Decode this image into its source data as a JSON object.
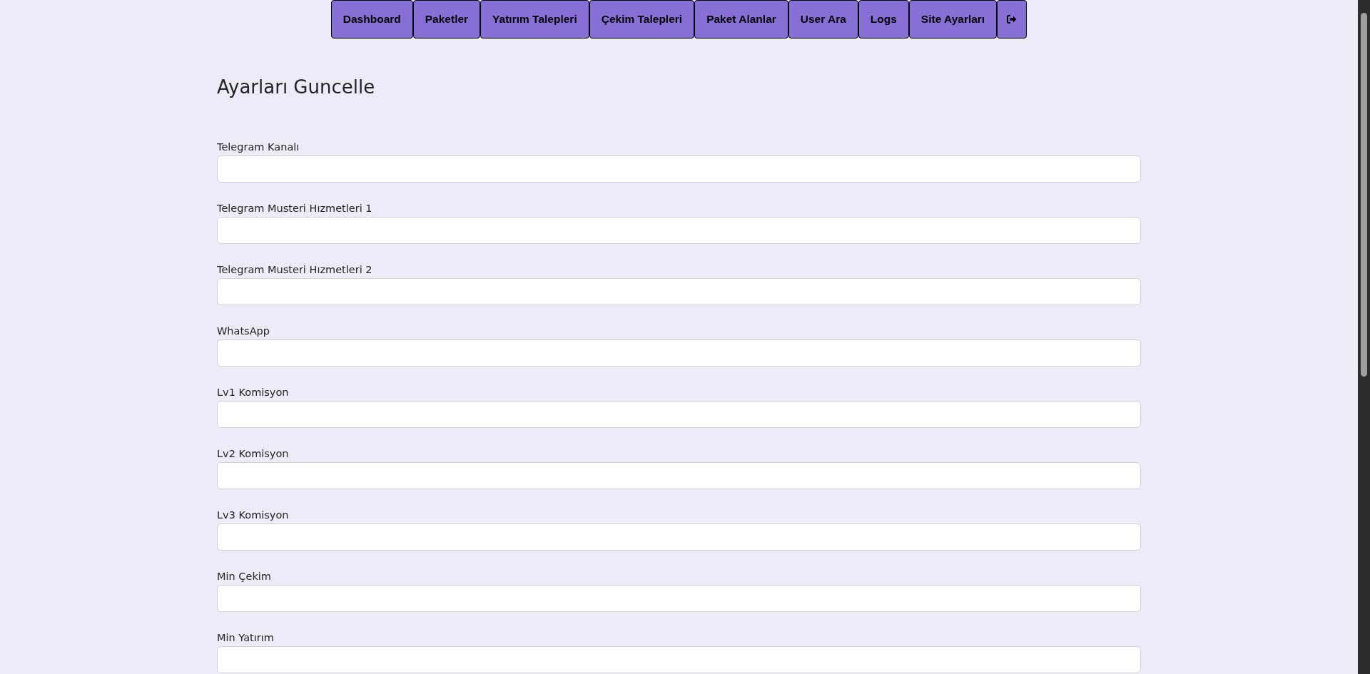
{
  "nav": [
    {
      "label": "Dashboard",
      "kind": "text"
    },
    {
      "label": "Paketler",
      "kind": "text"
    },
    {
      "label": "Yatırım Talepleri",
      "kind": "text"
    },
    {
      "label": "Çekim Talepleri",
      "kind": "text"
    },
    {
      "label": "Paket Alanlar",
      "kind": "text"
    },
    {
      "label": "User Ara",
      "kind": "text"
    },
    {
      "label": "Logs",
      "kind": "text"
    },
    {
      "label": "Site Ayarları",
      "kind": "text"
    },
    {
      "kind": "logout"
    }
  ],
  "title": "Ayarları Guncelle",
  "fields": [
    {
      "label": "Telegram Kanalı"
    },
    {
      "label": "Telegram Musteri Hızmetleri 1"
    },
    {
      "label": "Telegram Musteri Hızmetleri 2"
    },
    {
      "label": "WhatsApp"
    },
    {
      "label": "Lv1 Komisyon"
    },
    {
      "label": "Lv2 Komisyon"
    },
    {
      "label": "Lv3 Komisyon"
    },
    {
      "label": "Min Çekim"
    },
    {
      "label": "Min Yatırım"
    }
  ]
}
